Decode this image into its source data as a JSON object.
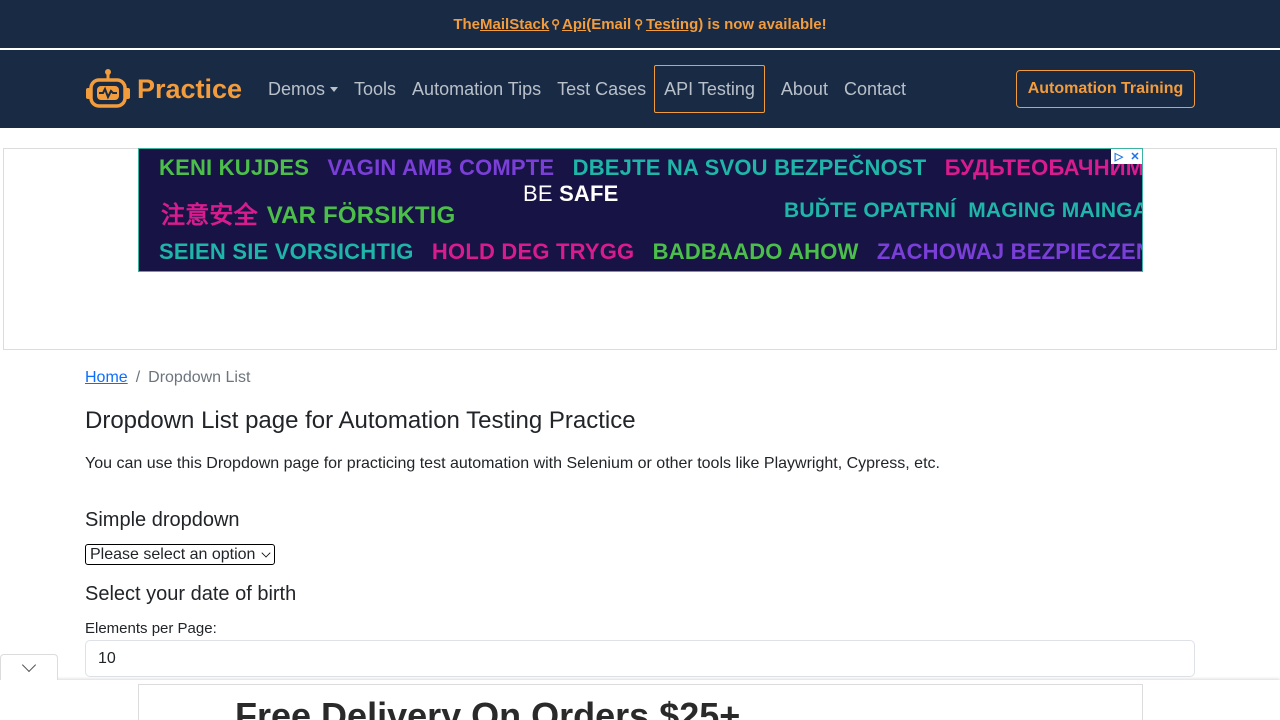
{
  "announcement": {
    "prefix": "The ",
    "link1": "MailStack",
    "mid1": " Api",
    "mid2": " (Email",
    "link2": "Testing",
    "suffix": ") is now available!"
  },
  "nav": {
    "brand": "Practice",
    "items": [
      "Demos",
      "Tools",
      "Automation Tips",
      "Test Cases",
      "API Testing",
      "About",
      "Contact"
    ],
    "training_button": "Automation Training"
  },
  "ad": {
    "row1": [
      "KENI KUJDES",
      "VAGIN AMB COMPTE",
      "DBEJTE NA SVOU BEZPEČNOST",
      "БУДЬТЕОБАЧНИМИ"
    ],
    "row2_left": [
      "注意安全",
      "VAR FÖRSIKTIG"
    ],
    "big_thin": "BE ",
    "big_bold": "SAFE",
    "row2_right": [
      "BUĎTE OPATRNÍ",
      "MAGING MAINGAT"
    ],
    "row3": [
      "SEIEN SIE VORSICHTIG",
      "HOLD DEG TRYGG",
      "BADBAADO AHOW",
      "ZACHOWAJ BEZPIECZEŃSTWO"
    ],
    "colors": {
      "green": "#4bbf4a",
      "purple": "#7a3fd6",
      "teal": "#1fb5a8",
      "magenta": "#d81b8f"
    }
  },
  "breadcrumb": {
    "home": "Home",
    "current": "Dropdown List"
  },
  "page_title": "Dropdown List page for Automation Testing Practice",
  "intro": "You can use this Dropdown page for practicing test automation with Selenium or other tools like Playwright, Cypress, etc.",
  "simple_dropdown": {
    "title": "Simple dropdown",
    "value": "Please select an option"
  },
  "dob": {
    "title": "Select your date of birth"
  },
  "elements_per_page": {
    "label": "Elements per Page:",
    "value": "10"
  },
  "sticky_ad": {
    "text": "Free Delivery On Orders $25+"
  },
  "colors": {
    "navy": "#182a44",
    "orange": "#f39c3c",
    "link": "#0d6efd"
  }
}
